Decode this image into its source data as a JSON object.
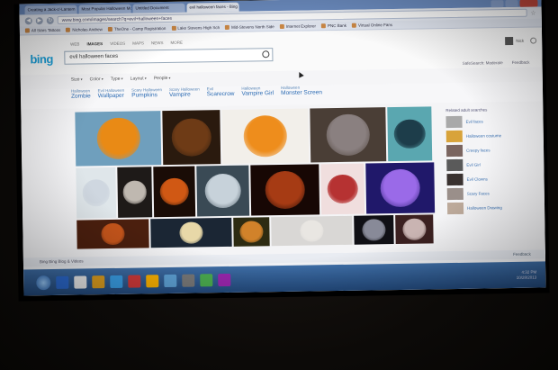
{
  "tabs": [
    {
      "label": "Creating a Jack-o'-Lantern",
      "active": false
    },
    {
      "label": "Most Popular Halloween Mo",
      "active": false
    },
    {
      "label": "Untitled Document",
      "active": false
    },
    {
      "label": "evil halloween faces - Bing",
      "active": true
    }
  ],
  "address": "www.bing.com/images/search?q=evil+halloween+faces",
  "bookmarks": [
    "All Stars Tattoos",
    "Nicholas Andrew",
    "TheOne - Camp Registration",
    "Lake Stevens High Sch",
    "Mid-Stevens North Side",
    "Internet Explorer",
    "PNC Bank",
    "Virtual Online Fans"
  ],
  "scopes": [
    "Web",
    "Images",
    "Videos",
    "Maps",
    "News",
    "More"
  ],
  "logo": "bing",
  "search_query": "evil halloween faces",
  "user_name": "Nick",
  "filters": [
    "Size",
    "Color",
    "Type",
    "Layout",
    "People"
  ],
  "right_tools": [
    "SafeSearch: Moderate",
    "Feedback"
  ],
  "related": [
    {
      "top": "Halloween",
      "bottom": "Zombie"
    },
    {
      "top": "Evil Halloween",
      "bottom": "Wallpaper"
    },
    {
      "top": "Scary Halloween",
      "bottom": "Pumpkins"
    },
    {
      "top": "Scary Halloween",
      "bottom": "Vampire"
    },
    {
      "top": "Evil",
      "bottom": "Scarecrow"
    },
    {
      "top": "Halloween",
      "bottom": "Vampire Girl"
    },
    {
      "top": "Halloween",
      "bottom": "Monster Screen"
    }
  ],
  "sidebar_title": "Related adult searches",
  "sidebar": [
    {
      "label": "Evil faces",
      "color": "#a9a9a9"
    },
    {
      "label": "Halloween costume",
      "color": "#d8a33a"
    },
    {
      "label": "Creepy faces",
      "color": "#7a6560"
    },
    {
      "label": "Evil Girl",
      "color": "#5a5a5a"
    },
    {
      "label": "Evil Clowns",
      "color": "#3a3230"
    },
    {
      "label": "Scary Faces",
      "color": "#9a8f8a"
    },
    {
      "label": "Halloween Drawing",
      "color": "#bca99a"
    }
  ],
  "thumbs": [
    [
      {
        "w": 95,
        "bg": "#6f9fbd",
        "face": "#e98a15"
      },
      {
        "w": 64,
        "bg": "#2a1a0e",
        "face": "#6e3b16"
      },
      {
        "w": 96,
        "bg": "#f2efea",
        "face": "#ee8d1c"
      },
      {
        "w": 84,
        "bg": "#4a3e36",
        "face": "#8a8080"
      },
      {
        "w": 49,
        "bg": "#5aa7b0",
        "face": "#1d3d4a"
      }
    ],
    [
      {
        "w": 44,
        "bg": "#dfe6ea",
        "face": "#cfd7e0"
      },
      {
        "w": 38,
        "bg": "#1e1a18",
        "face": "#bfb8b0"
      },
      {
        "w": 46,
        "bg": "#1a0c06",
        "face": "#d05814"
      },
      {
        "w": 58,
        "bg": "#3a4a55",
        "face": "#c7d2da"
      },
      {
        "w": 76,
        "bg": "#170704",
        "face": "#a63b14"
      },
      {
        "w": 48,
        "bg": "#f0dede",
        "face": "#b63232"
      },
      {
        "w": 76,
        "bg": "#20186a",
        "face": "#9a6ae8"
      }
    ],
    [
      {
        "w": 80,
        "bg": "#4b1f0e",
        "face": "#c5551b"
      },
      {
        "w": 90,
        "bg": "#1b2634",
        "face": "#e8d8a8"
      },
      {
        "w": 40,
        "bg": "#2d2b12",
        "face": "#d1822a"
      },
      {
        "w": 90,
        "bg": "#d9d7d5",
        "face": "#e9e6e2"
      },
      {
        "w": 44,
        "bg": "#101015",
        "face": "#888a98"
      },
      {
        "w": 42,
        "bg": "#3b2020",
        "face": "#c9b4b2"
      }
    ]
  ],
  "status": "Bing Bing Blog & Videos",
  "feedback": "Feedback",
  "clock_time": "4:32 PM",
  "clock_date": "10/28/2013",
  "taskbar_colors": [
    "#2c6bd2",
    "#f0f0f0",
    "#e0a020",
    "#3aa0e8",
    "#d23a3a",
    "#ffb400",
    "#5fa3d8",
    "#7a7a7a",
    "#4caf50",
    "#9c27b0"
  ]
}
